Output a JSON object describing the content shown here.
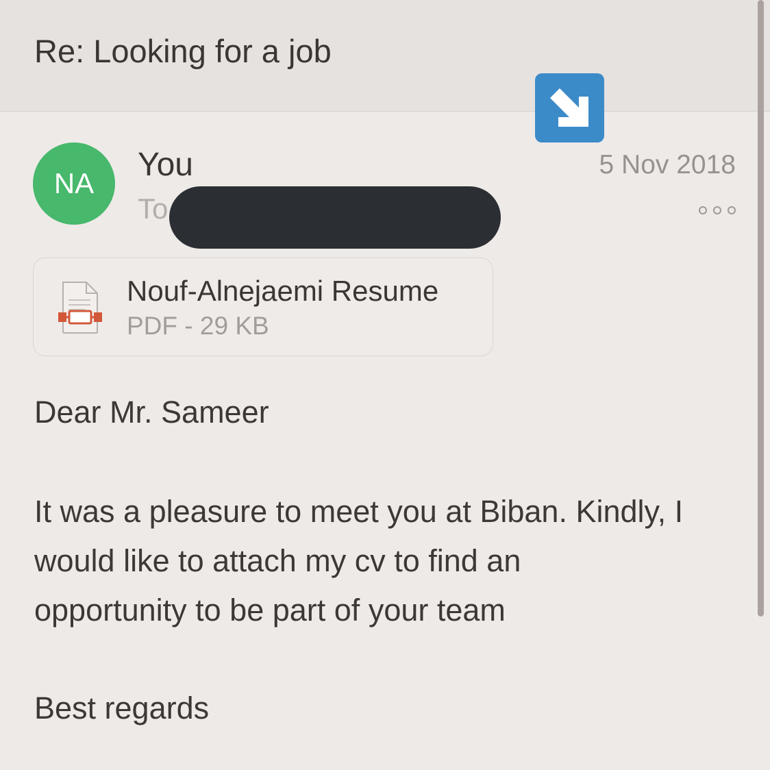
{
  "header": {
    "subject": "Re: Looking for a job"
  },
  "message": {
    "avatar_initials": "NA",
    "sender": "You",
    "to_label": "To",
    "date": "5 Nov 2018",
    "more_label": "∘∘∘"
  },
  "attachment": {
    "name": "Nouf-Alnejaemi Resume",
    "meta": "PDF - 29 KB",
    "icon": "pdf-file-icon"
  },
  "body": {
    "greeting": "Dear Mr. Sameer",
    "lines": [
      "It was a pleasure to meet you at Biban. Kindly, I",
      "would like to attach my cv to find an",
      "opportunity to be part of your team"
    ],
    "closing": "Best regards"
  },
  "colors": {
    "avatar": "#47b86c",
    "expand_button": "#3c8bc9",
    "redaction": "#2b2f33",
    "pdf_accent": "#d2583a"
  }
}
